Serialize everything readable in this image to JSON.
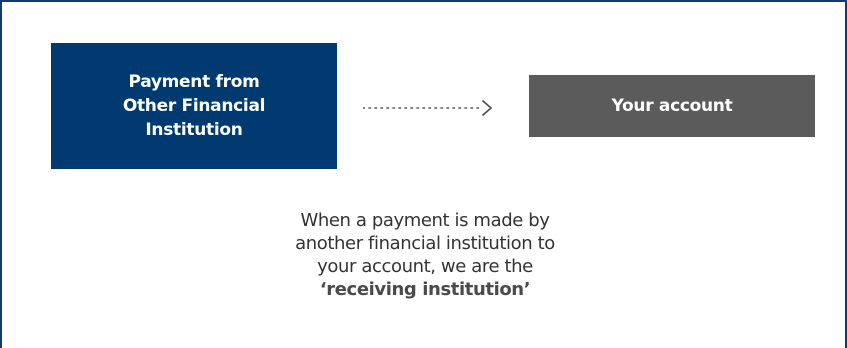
{
  "diagram": {
    "source_box": {
      "label": "Payment from Other Financial Institution",
      "color": "#003a70"
    },
    "arrow": {
      "icon": "dotted-arrow-right-icon",
      "color": "#555555"
    },
    "target_box": {
      "label": "Your account",
      "color": "#5b5b5b"
    },
    "caption": {
      "lines": [
        "When a payment is made by",
        "another financial institution to",
        "your account, we are the"
      ],
      "emphasis": "‘receiving institution’"
    },
    "border_color": "#123a6d"
  }
}
